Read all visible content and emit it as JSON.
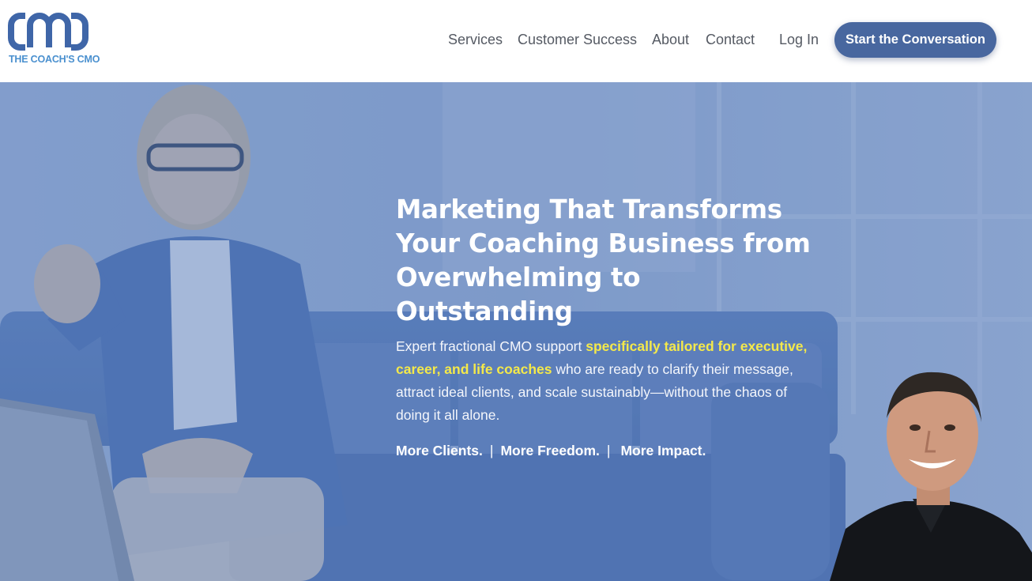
{
  "header": {
    "logo": {
      "mark_text": "CMO",
      "tagline": "THE COACH'S CMO"
    },
    "nav": [
      {
        "label": "Services"
      },
      {
        "label": "Customer Success"
      },
      {
        "label": "About"
      },
      {
        "label": "Contact"
      },
      {
        "label": "Log In"
      }
    ],
    "cta_label": "Start the Conversation"
  },
  "hero": {
    "title_lines": [
      "Marketing That Transforms",
      "Your Coaching Business from",
      "Overwhelming to Outstanding"
    ],
    "description": {
      "part1": "Expert fractional CMO support ",
      "highlight": "specifically tailored for executive, career, and life coaches",
      "part2": " who are ready to clarify their message, attract ideal clients, and scale sustainably—without the chaos of doing it all alone."
    },
    "taglines": [
      "More Clients.",
      "More Freedom.",
      "More Impact."
    ],
    "separator": "|"
  },
  "colors": {
    "brand_blue": "#48679f",
    "logo_blue": "#3f66a8",
    "logo_text": "#4a90cf",
    "highlight_yellow": "#f4e94a",
    "nav_text": "#555a63"
  },
  "icons": {
    "logo": "cmo-monogram",
    "hero_background": "coaching-session-photo",
    "portrait": "coach-headshot-photo"
  }
}
